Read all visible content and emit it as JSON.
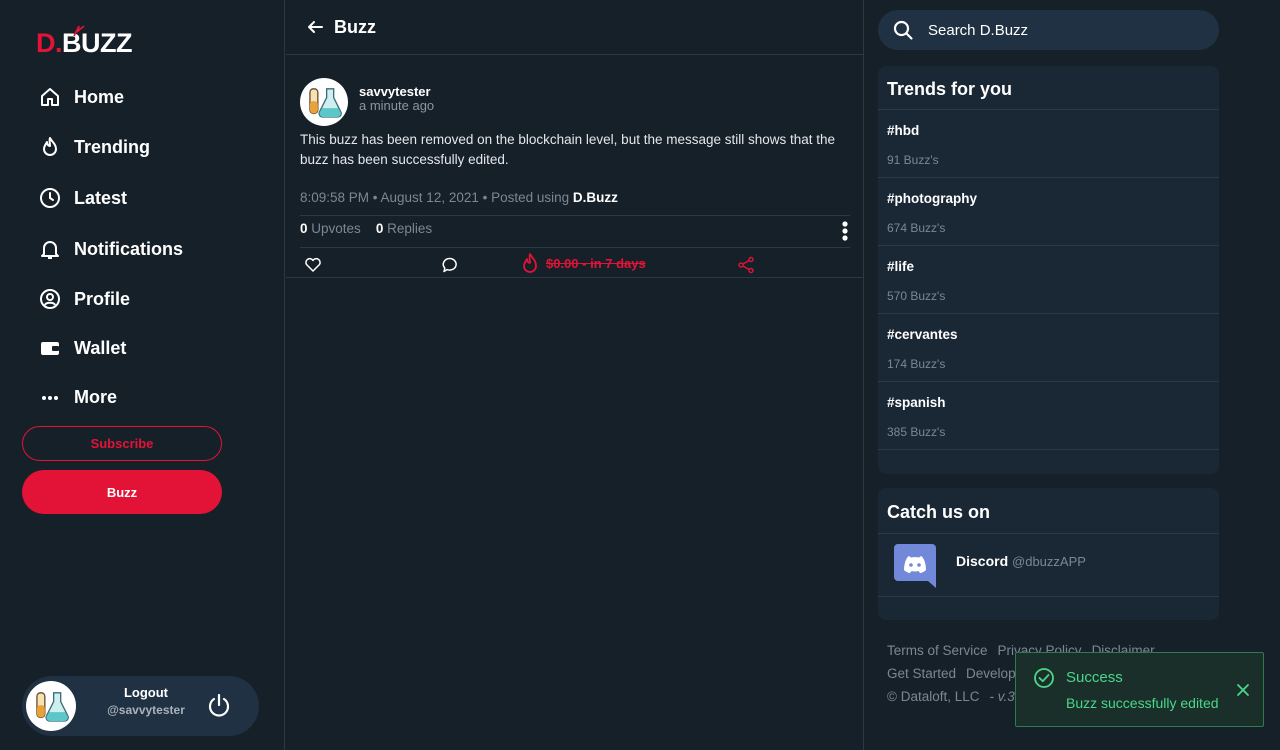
{
  "logo": {
    "part1": "D.",
    "part2": "BUZZ"
  },
  "nav": [
    {
      "id": "home",
      "label": "Home",
      "icon": "home-icon"
    },
    {
      "id": "trending",
      "label": "Trending",
      "icon": "flame-icon"
    },
    {
      "id": "latest",
      "label": "Latest",
      "icon": "clock-icon"
    },
    {
      "id": "notifications",
      "label": "Notifications",
      "icon": "bell-icon"
    },
    {
      "id": "profile",
      "label": "Profile",
      "icon": "user-circle-icon"
    },
    {
      "id": "wallet",
      "label": "Wallet",
      "icon": "wallet-icon"
    },
    {
      "id": "more",
      "label": "More",
      "icon": "more-dots-icon"
    }
  ],
  "buttons": {
    "subscribe": "Subscribe",
    "buzz": "Buzz"
  },
  "user": {
    "action": "Logout",
    "handle": "@savvytester"
  },
  "main": {
    "title": "Buzz",
    "post": {
      "author": "savvytester",
      "ago": "a minute ago",
      "body": "This buzz has been removed on the blockchain level, but the message still shows that the buzz has been successfully edited.",
      "stamp_prefix": "8:09:58 PM • August 12, 2021 • Posted using ",
      "stamp_app": "D.Buzz",
      "upvotes_count": "0",
      "upvotes_label": " Upvotes",
      "replies_count": "0",
      "replies_label": " Replies",
      "payout": "$0.00 - in 7 days"
    }
  },
  "search": {
    "placeholder": "Search D.Buzz"
  },
  "trends": {
    "title": "Trends for you",
    "items": [
      {
        "tag": "#hbd",
        "count": "91 Buzz's"
      },
      {
        "tag": "#photography",
        "count": "674 Buzz's"
      },
      {
        "tag": "#life",
        "count": "570 Buzz's"
      },
      {
        "tag": "#cervantes",
        "count": "174 Buzz's"
      },
      {
        "tag": "#spanish",
        "count": "385 Buzz's"
      }
    ]
  },
  "catch": {
    "title": "Catch us on",
    "name": "Discord",
    "handle": "@dbuzzAPP"
  },
  "footer": {
    "terms": "Terms of Service",
    "privacy": "Privacy Policy",
    "disclaimer": "Disclaimer",
    "started": "Get Started",
    "developers": "Develop",
    "copyright": "© Dataloft, LLC",
    "version": "- v.3."
  },
  "toast": {
    "title": "Success",
    "message": "Buzz successfully edited"
  },
  "colors": {
    "accent": "#e31337",
    "bg": "#162029",
    "panel": "#1a2735",
    "success": "#4cd68a"
  }
}
